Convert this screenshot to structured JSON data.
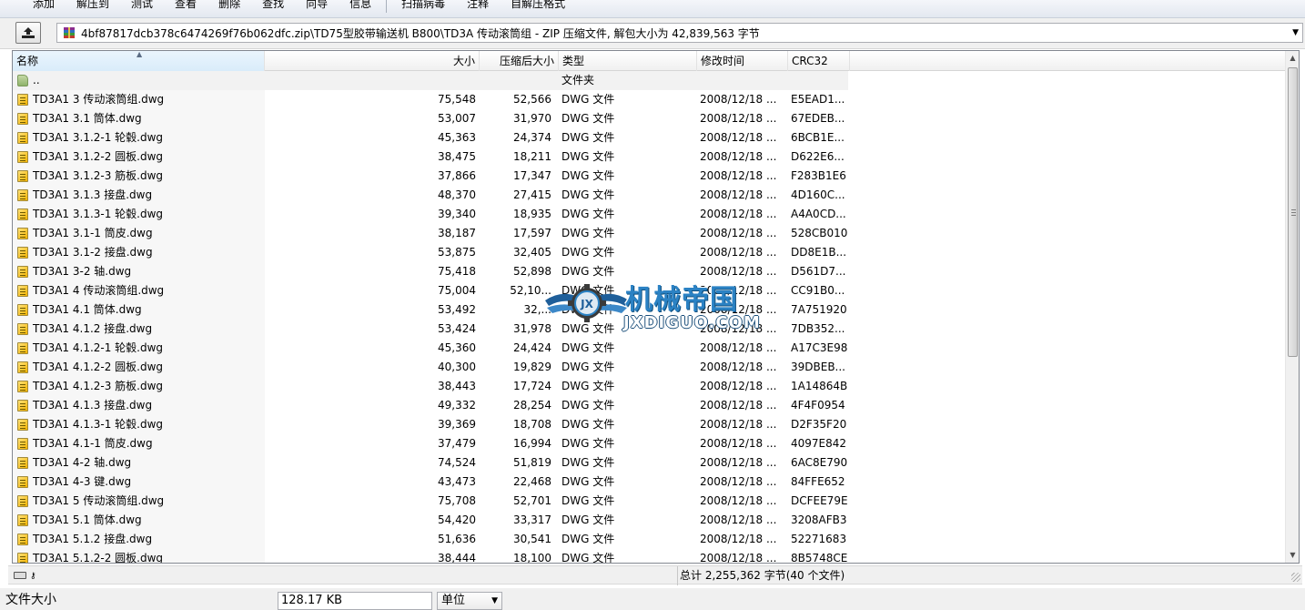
{
  "toolbar": {
    "items": [
      "添加",
      "解压到",
      "测试",
      "查看",
      "删除",
      "查找",
      "向导",
      "信息",
      "扫描病毒",
      "注释",
      "自解压格式"
    ]
  },
  "address": {
    "path": "4bf87817dcb378c6474269f76b062dfc.zip\\TD75型胶带输送机  B800\\TD3A 传动滚筒组 - ZIP 压缩文件, 解包大小为 42,839,563 字节"
  },
  "columns": {
    "name": "名称",
    "size": "大小",
    "packed": "压缩后大小",
    "type": "类型",
    "modified": "修改时间",
    "crc": "CRC32"
  },
  "parent_row": {
    "name": "..",
    "type": "文件夹"
  },
  "files": [
    {
      "name": "TD3A1 3 传动滚筒组.dwg",
      "size": "75,548",
      "packed": "52,566",
      "type": "DWG 文件",
      "modified": "2008/12/18 ...",
      "crc": "E5EAD1..."
    },
    {
      "name": "TD3A1 3.1 筒体.dwg",
      "size": "53,007",
      "packed": "31,970",
      "type": "DWG 文件",
      "modified": "2008/12/18 ...",
      "crc": "67EDEB..."
    },
    {
      "name": "TD3A1 3.1.2-1 轮毂.dwg",
      "size": "45,363",
      "packed": "24,374",
      "type": "DWG 文件",
      "modified": "2008/12/18 ...",
      "crc": "6BCB1E..."
    },
    {
      "name": "TD3A1 3.1.2-2 圆板.dwg",
      "size": "38,475",
      "packed": "18,211",
      "type": "DWG 文件",
      "modified": "2008/12/18 ...",
      "crc": "D622E6..."
    },
    {
      "name": "TD3A1 3.1.2-3 筋板.dwg",
      "size": "37,866",
      "packed": "17,347",
      "type": "DWG 文件",
      "modified": "2008/12/18 ...",
      "crc": "F283B1E6"
    },
    {
      "name": "TD3A1 3.1.3 接盘.dwg",
      "size": "48,370",
      "packed": "27,415",
      "type": "DWG 文件",
      "modified": "2008/12/18 ...",
      "crc": "4D160C..."
    },
    {
      "name": "TD3A1 3.1.3-1 轮毂.dwg",
      "size": "39,340",
      "packed": "18,935",
      "type": "DWG 文件",
      "modified": "2008/12/18 ...",
      "crc": "A4A0CD..."
    },
    {
      "name": "TD3A1 3.1-1 筒皮.dwg",
      "size": "38,187",
      "packed": "17,597",
      "type": "DWG 文件",
      "modified": "2008/12/18 ...",
      "crc": "528CB010"
    },
    {
      "name": "TD3A1 3.1-2 接盘.dwg",
      "size": "53,875",
      "packed": "32,405",
      "type": "DWG 文件",
      "modified": "2008/12/18 ...",
      "crc": "DD8E1B..."
    },
    {
      "name": "TD3A1 3-2 轴.dwg",
      "size": "75,418",
      "packed": "52,898",
      "type": "DWG 文件",
      "modified": "2008/12/18 ...",
      "crc": "D561D7..."
    },
    {
      "name": "TD3A1 4 传动滚筒组.dwg",
      "size": "75,004",
      "packed": "52,10...",
      "type": "DWG 文件",
      "modified": "2008/12/18 ...",
      "crc": "CC91B0..."
    },
    {
      "name": "TD3A1 4.1 筒体.dwg",
      "size": "53,492",
      "packed": "32,...",
      "type": "DWG 文件",
      "modified": "2008/12/18 ...",
      "crc": "7A751920"
    },
    {
      "name": "TD3A1 4.1.2 接盘.dwg",
      "size": "53,424",
      "packed": "31,978",
      "type": "DWG 文件",
      "modified": "2008/12/18 ...",
      "crc": "7DB352..."
    },
    {
      "name": "TD3A1 4.1.2-1 轮毂.dwg",
      "size": "45,360",
      "packed": "24,424",
      "type": "DWG 文件",
      "modified": "2008/12/18 ...",
      "crc": "A17C3E98"
    },
    {
      "name": "TD3A1 4.1.2-2 圆板.dwg",
      "size": "40,300",
      "packed": "19,829",
      "type": "DWG 文件",
      "modified": "2008/12/18 ...",
      "crc": "39DBEB..."
    },
    {
      "name": "TD3A1 4.1.2-3 筋板.dwg",
      "size": "38,443",
      "packed": "17,724",
      "type": "DWG 文件",
      "modified": "2008/12/18 ...",
      "crc": "1A14864B"
    },
    {
      "name": "TD3A1 4.1.3 接盘.dwg",
      "size": "49,332",
      "packed": "28,254",
      "type": "DWG 文件",
      "modified": "2008/12/18 ...",
      "crc": "4F4F0954"
    },
    {
      "name": "TD3A1 4.1.3-1 轮毂.dwg",
      "size": "39,369",
      "packed": "18,708",
      "type": "DWG 文件",
      "modified": "2008/12/18 ...",
      "crc": "D2F35F20"
    },
    {
      "name": "TD3A1 4.1-1 筒皮.dwg",
      "size": "37,479",
      "packed": "16,994",
      "type": "DWG 文件",
      "modified": "2008/12/18 ...",
      "crc": "4097E842"
    },
    {
      "name": "TD3A1 4-2 轴.dwg",
      "size": "74,524",
      "packed": "51,819",
      "type": "DWG 文件",
      "modified": "2008/12/18 ...",
      "crc": "6AC8E790"
    },
    {
      "name": "TD3A1 4-3 键.dwg",
      "size": "43,473",
      "packed": "22,468",
      "type": "DWG 文件",
      "modified": "2008/12/18 ...",
      "crc": "84FFE652"
    },
    {
      "name": "TD3A1 5 传动滚筒组.dwg",
      "size": "75,708",
      "packed": "52,701",
      "type": "DWG 文件",
      "modified": "2008/12/18 ...",
      "crc": "DCFEE79E"
    },
    {
      "name": "TD3A1 5.1 筒体.dwg",
      "size": "54,420",
      "packed": "33,317",
      "type": "DWG 文件",
      "modified": "2008/12/18 ...",
      "crc": "3208AFB3"
    },
    {
      "name": "TD3A1 5.1.2 接盘.dwg",
      "size": "51,636",
      "packed": "30,541",
      "type": "DWG 文件",
      "modified": "2008/12/18 ...",
      "crc": "52271683"
    },
    {
      "name": "TD3A1 5.1.2-2 圆板.dwg",
      "size": "38,444",
      "packed": "18,100",
      "type": "DWG 文件",
      "modified": "2008/12/18 ...",
      "crc": "8B5748CE"
    }
  ],
  "status": {
    "total": "总计 2,255,362 字节(40 个文件)"
  },
  "bottom": {
    "file_size_label": "文件大小",
    "file_size_value": "128.17 KB",
    "unit_label": "单位"
  },
  "watermark": {
    "title": "机械帝国",
    "subtitle": "JXDIGUO.COM",
    "badge": "JX"
  },
  "colors": {
    "watermark_blue": "#2b82c4",
    "header_sorted": "#d9ecfa",
    "name_column_bg": "#f7f7f7"
  }
}
